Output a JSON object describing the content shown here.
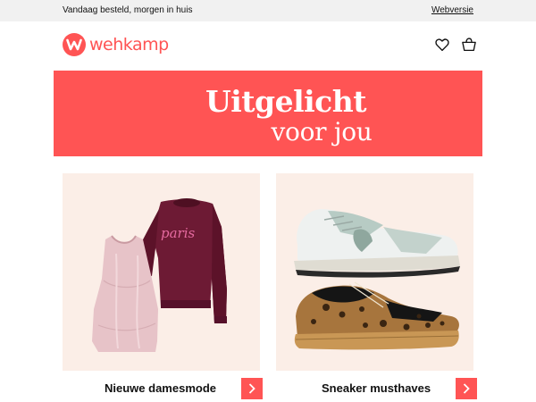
{
  "topbar": {
    "delivery_text": "Vandaag besteld, morgen in huis",
    "web_version_link": "Webversie"
  },
  "header": {
    "logo_text": "wehkamp",
    "icons": [
      "heart-icon",
      "shopping-bag-icon"
    ]
  },
  "hero": {
    "line1": "Uitgelicht",
    "line2": "voor jou"
  },
  "cards": [
    {
      "label": "Nieuwe damesmode",
      "image": "womens-clothing-image",
      "sweater_script_text": "paris"
    },
    {
      "label": "Sneaker musthaves",
      "image": "sneakers-image"
    }
  ],
  "colors": {
    "brand": "#ff5454",
    "topbar_bg": "#f1f1f1",
    "card_bg": "#fbeee7",
    "text": "#111111"
  }
}
